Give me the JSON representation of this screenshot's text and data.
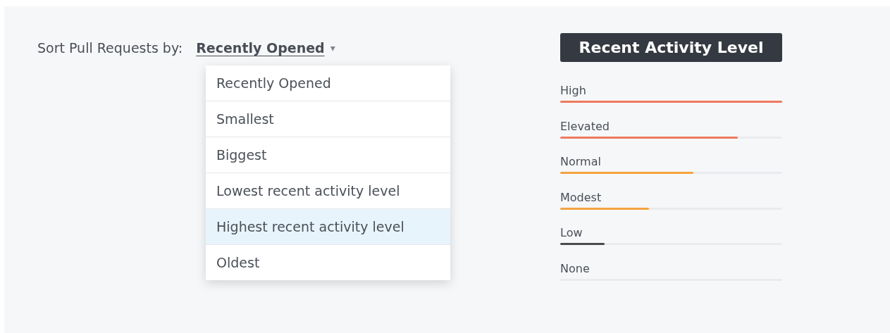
{
  "sort": {
    "label": "Sort Pull Requests by:",
    "value": "Recently Opened",
    "caret": "▾",
    "options": [
      {
        "label": "Recently Opened",
        "highlighted": false
      },
      {
        "label": "Smallest",
        "highlighted": false
      },
      {
        "label": "Biggest",
        "highlighted": false
      },
      {
        "label": "Lowest recent activity level",
        "highlighted": false
      },
      {
        "label": "Highest recent activity level",
        "highlighted": true
      },
      {
        "label": "Oldest",
        "highlighted": false
      }
    ]
  },
  "legend": {
    "title": "Recent Activity Level",
    "levels": [
      {
        "label": "High",
        "level": 1,
        "color": "#ef7a5e"
      },
      {
        "label": "Elevated",
        "level": 0.8,
        "color": "#ef7a5e"
      },
      {
        "label": "Normal",
        "level": 0.6,
        "color": "#f4a340"
      },
      {
        "label": "Modest",
        "level": 0.4,
        "color": "#f4a340"
      },
      {
        "label": "Low",
        "level": 0.2,
        "color": "#4a4a4a"
      },
      {
        "label": "None"
      }
    ]
  }
}
